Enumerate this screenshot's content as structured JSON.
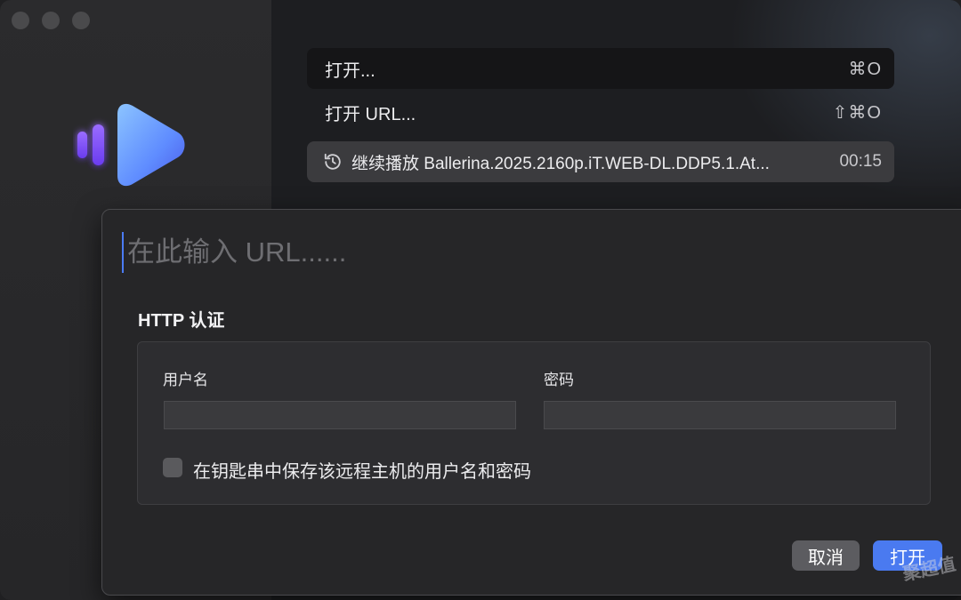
{
  "window": {
    "traffic_lights": [
      "close",
      "minimize",
      "zoom"
    ]
  },
  "launcher": {
    "items": [
      {
        "label": "打开...",
        "shortcut": "⌘O"
      },
      {
        "label": "打开 URL...",
        "shortcut": "⇧⌘O"
      }
    ],
    "resume": {
      "icon": "history-clock-icon",
      "label": "继续播放 Ballerina.2025.2160p.iT.WEB-DL.DDP5.1.At...",
      "time": "00:15"
    }
  },
  "sheet": {
    "url_placeholder": "在此输入 URL......",
    "url_value": "",
    "http_auth_title": "HTTP 认证",
    "username_label": "用户名",
    "password_label": "密码",
    "username_value": "",
    "password_value": "",
    "save_keychain_label": "在钥匙串中保存该远程主机的用户名和密码",
    "save_keychain_checked": false,
    "cancel_label": "取消",
    "open_label": "打开"
  },
  "watermark": "聚超值",
  "colors": {
    "accent": "#4a7af0",
    "logo_play_start": "#7fb0ff",
    "logo_play_end": "#5a6cf0",
    "logo_bars": "#7a4cf5"
  }
}
